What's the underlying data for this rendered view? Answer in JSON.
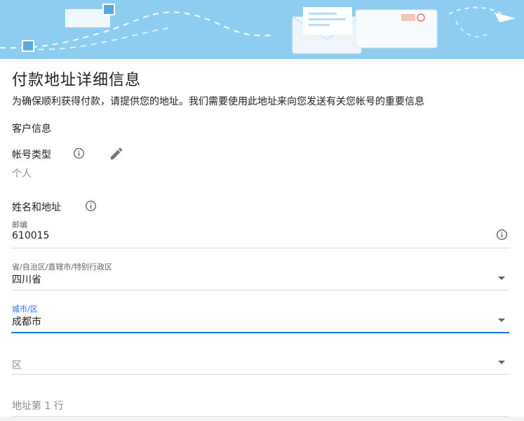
{
  "page": {
    "title": "付款地址详细信息",
    "subtitle": "为确保顺利获得付款，请提供您的地址。我们需要使用此地址来向您发送有关您帐号的重要信息"
  },
  "customer_section": {
    "heading": "客户信息",
    "account_type_label": "帐号类型",
    "account_type_value": "个人"
  },
  "name_address_section": {
    "heading": "姓名和地址"
  },
  "fields": {
    "postal_code": {
      "label": "邮编",
      "value": "610015"
    },
    "province": {
      "label": "省/自治区/直辖市/特别行政区",
      "value": "四川省"
    },
    "city": {
      "label": "城市/区",
      "value": "成都市"
    },
    "district": {
      "placeholder": "区"
    },
    "address_line1": {
      "placeholder": "地址第 1 行"
    }
  },
  "colors": {
    "banner": "#8fcdf0",
    "accent": "#1a73e8",
    "envelope": "#eef6fc"
  },
  "icons": {
    "info": "info-circle-icon",
    "edit": "pencil-icon",
    "dropdown": "caret-down-icon",
    "banner": "envelope-illustration"
  }
}
